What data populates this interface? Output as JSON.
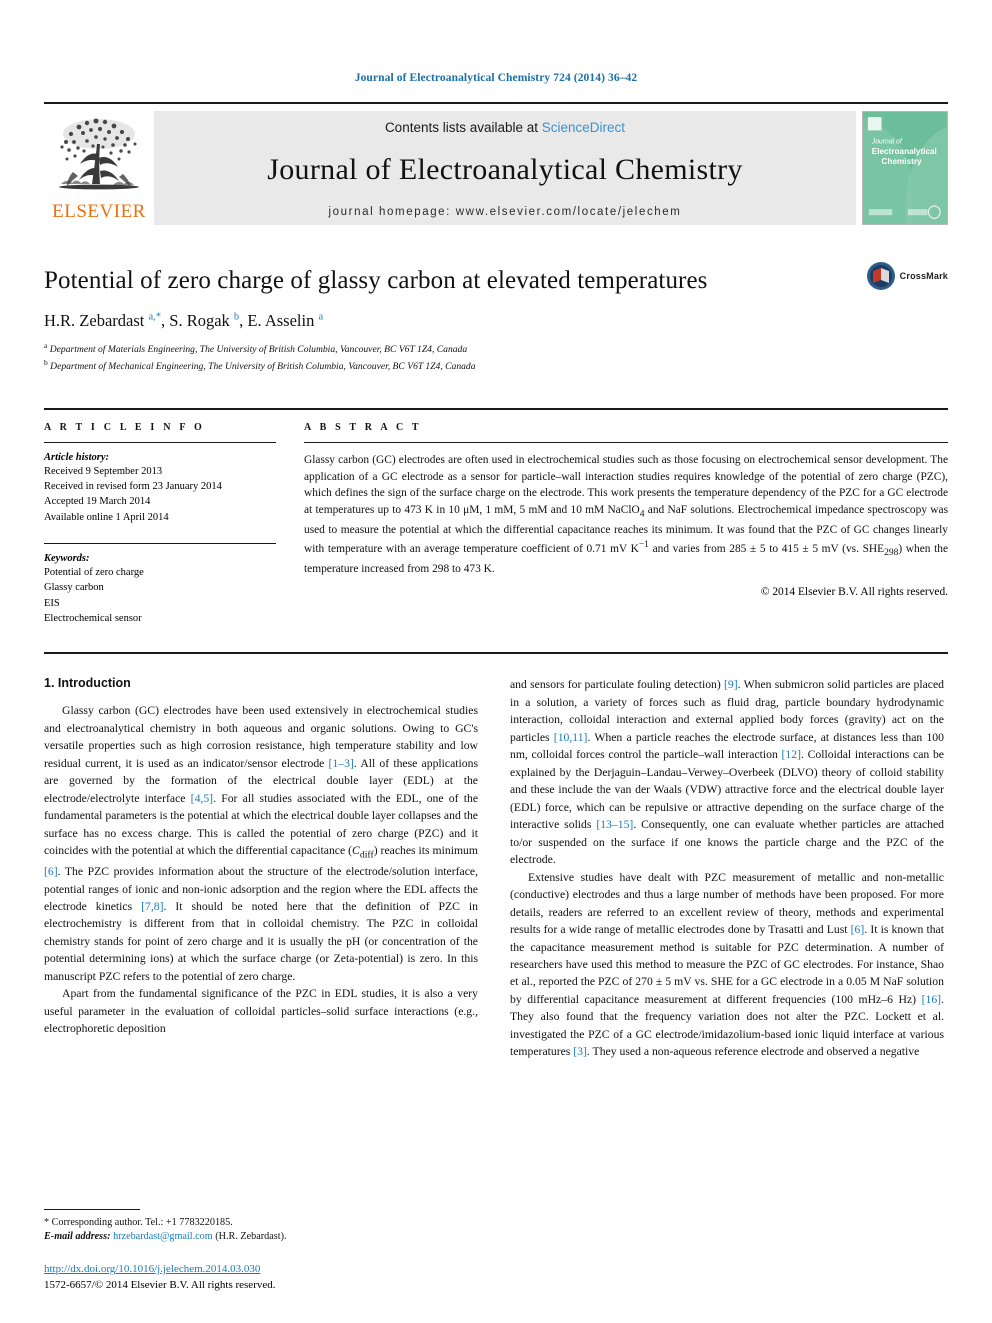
{
  "running_head": "Journal of Electroanalytical Chemistry 724 (2014) 36–42",
  "banner": {
    "publisher_name": "ELSEVIER",
    "contents_prefix": "Contents lists available at ",
    "sciencedirect": "ScienceDirect",
    "journal_title": "Journal of Electroanalytical Chemistry",
    "homepage": "journal homepage: www.elsevier.com/locate/jelechem",
    "cover_title_line1": "Journal of",
    "cover_title_line2": "Electroanalytical",
    "cover_title_line3": "Chemistry"
  },
  "article": {
    "title": "Potential of zero charge of glassy carbon at elevated temperatures",
    "authors_html": "H.R. Zebardast <sup>a,*</sup>, S. Rogak <sup>b</sup>, E. Asselin <sup>a</sup>",
    "affiliation_a": "Department of Materials Engineering, The University of British Columbia, Vancouver, BC V6T 1Z4, Canada",
    "affiliation_b": "Department of Mechanical Engineering, The University of British Columbia, Vancouver, BC V6T 1Z4, Canada",
    "crossmark_label": "CrossMark"
  },
  "info": {
    "heading": "A R T I C L E   I N F O",
    "history_label": "Article history:",
    "history": [
      "Received 9 September 2013",
      "Received in revised form 23 January 2014",
      "Accepted 19 March 2014",
      "Available online 1 April 2014"
    ],
    "keywords_label": "Keywords:",
    "keywords": [
      "Potential of zero charge",
      "Glassy carbon",
      "EIS",
      "Electrochemical sensor"
    ]
  },
  "abstract": {
    "heading": "A B S T R A C T",
    "text_html": "Glassy carbon (GC) electrodes are often used in electrochemical studies such as those focusing on electrochemical sensor development. The application of a GC electrode as a sensor for particle–wall interaction studies requires knowledge of the potential of zero charge (PZC), which defines the sign of the surface charge on the electrode. This work presents the temperature dependency of the PZC for a GC electrode at temperatures up to 473 K in 10 μM, 1 mM, 5 mM and 10 mM NaClO<sub>4</sub> and NaF solutions. Electrochemical impedance spectroscopy was used to measure the potential at which the differential capacitance reaches its minimum. It was found that the PZC of GC changes linearly with temperature with an average temperature coefficient of 0.71 mV K<sup>−1</sup> and varies from 285 ± 5 to 415 ± 5 mV (vs. SHE<sub>298</sub>) when the temperature increased from 298 to 473 K.",
    "copyright": "© 2014 Elsevier B.V. All rights reserved."
  },
  "body": {
    "section_title": "1. Introduction",
    "left_paragraphs_html": [
      "Glassy carbon (GC) electrodes have been used extensively in electrochemical studies and electroanalytical chemistry in both aqueous and organic solutions. Owing to GC's versatile properties such as high corrosion resistance, high temperature stability and low residual current, it is used as an indicator/sensor electrode <span class=\"ref\">[1–3]</span>. All of these applications are governed by the formation of the electrical double layer (EDL) at the electrode/electrolyte interface <span class=\"ref\">[4,5]</span>. For all studies associated with the EDL, one of the fundamental parameters is the potential at which the electrical double layer collapses and the surface has no excess charge. This is called the potential of zero charge (PZC) and it coincides with the potential at which the differential capacitance (<i>C</i><sub>diff</sub>) reaches its minimum <span class=\"ref\">[6]</span>. The PZC provides information about the structure of the electrode/solution interface, potential ranges of ionic and non-ionic adsorption and the region where the EDL affects the electrode kinetics <span class=\"ref\">[7,8]</span>. It should be noted here that the definition of PZC in electrochemistry is different from that in colloidal chemistry. The PZC in colloidal chemistry stands for point of zero charge and it is usually the pH (or concentration of the potential determining ions) at which the surface charge (or Zeta-potential) is zero. In this manuscript PZC refers to the potential of zero charge.",
      "Apart from the fundamental significance of the PZC in EDL studies, it is also a very useful parameter in the evaluation of colloidal particles–solid surface interactions (e.g., electrophoretic deposition"
    ],
    "right_paragraphs_html": [
      "and sensors for particulate fouling detection) <span class=\"ref\">[9]</span>. When submicron solid particles are placed in a solution, a variety of forces such as fluid drag, particle boundary hydrodynamic interaction, colloidal interaction and external applied body forces (gravity) act on the particles <span class=\"ref\">[10,11]</span>. When a particle reaches the electrode surface, at distances less than 100 nm, colloidal forces control the particle–wall interaction <span class=\"ref\">[12]</span>. Colloidal interactions can be explained by the Derjaguin–Landau–Verwey–Overbeek (DLVO) theory of colloid stability and these include the van der Waals (VDW) attractive force and the electrical double layer (EDL) force, which can be repulsive or attractive depending on the surface charge of the interactive solids <span class=\"ref\">[13–15]</span>. Consequently, one can evaluate whether particles are attached to/or suspended on the surface if one knows the particle charge and the PZC of the electrode.",
      "Extensive studies have dealt with PZC measurement of metallic and non-metallic (conductive) electrodes and thus a large number of methods have been proposed. For more details, readers are referred to an excellent review of theory, methods and experimental results for a wide range of metallic electrodes done by Trasatti and Lust <span class=\"ref\">[6]</span>. It is known that the capacitance measurement method is suitable for PZC determination. A number of researchers have used this method to measure the PZC of GC electrodes. For instance, Shao et al., reported the PZC of 270 ± 5 mV vs. SHE for a GC electrode in a 0.05 M NaF solution by differential capacitance measurement at different frequencies (100 mHz–6 Hz) <span class=\"ref\">[16]</span>. They also found that the frequency variation does not alter the PZC. Lockett et al. investigated the PZC of a GC electrode/imidazolium-based ionic liquid interface at various temperatures <span class=\"ref\">[3]</span>. They used a non-aqueous reference electrode and observed a negative"
    ]
  },
  "footnotes": {
    "corresponding_author": "* Corresponding author. Tel.: +1 7783220185.",
    "email_label": "E-mail address:",
    "email": "hrzebardast@gmail.com",
    "email_suffix": "(H.R. Zebardast).",
    "doi": "http://dx.doi.org/10.1016/j.jelechem.2014.03.030",
    "issn_line": "1572-6657/© 2014 Elsevier B.V. All rights reserved."
  },
  "colors": {
    "link_blue": "#1a7bb9",
    "sciencedirect_blue": "#3b92cf",
    "elsevier_orange": "#e87211",
    "banner_gray": "#e9e9e9",
    "cover_green": "#6cbf9a"
  }
}
